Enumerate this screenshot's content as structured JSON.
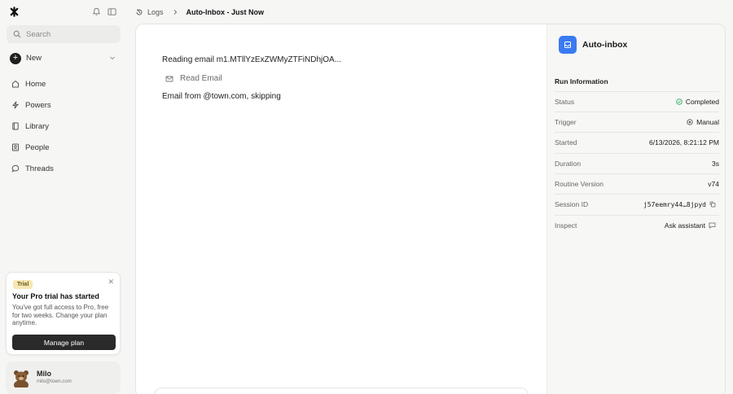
{
  "sidebar": {
    "search_placeholder": "Search",
    "new_label": "New",
    "nav": [
      {
        "label": "Home",
        "icon": "home-icon"
      },
      {
        "label": "Powers",
        "icon": "lightning-icon"
      },
      {
        "label": "Library",
        "icon": "book-icon"
      },
      {
        "label": "People",
        "icon": "contact-card-icon"
      },
      {
        "label": "Threads",
        "icon": "chat-bubble-icon"
      }
    ],
    "trial": {
      "badge": "Trial",
      "title": "Your Pro trial has started",
      "body": "You've got full access to Pro, free for two weeks. Change your plan anytime.",
      "button": "Manage plan"
    },
    "user": {
      "name": "Milo",
      "email": "milo@town.com"
    }
  },
  "breadcrumb": {
    "root": "Logs",
    "current": "Auto-Inbox - Just Now"
  },
  "log": {
    "line1": "Reading email m1.MTllYzExZWMyZTFiNDhjOA...",
    "tool": "Read Email",
    "line3": "Email from @town.com, skipping"
  },
  "panel": {
    "app_title": "Auto-inbox",
    "section_title": "Run Information",
    "rows": [
      {
        "key": "Status",
        "value": "Completed"
      },
      {
        "key": "Trigger",
        "value": "Manual"
      },
      {
        "key": "Started",
        "value": "6/13/2026, 8:21:12 PM"
      },
      {
        "key": "Duration",
        "value": "3s"
      },
      {
        "key": "Routine Version",
        "value": "v74"
      },
      {
        "key": "Session ID",
        "value": "j57eemry44…8jpyd"
      },
      {
        "key": "Inspect",
        "value": "Ask assistant"
      }
    ]
  },
  "colors": {
    "accent": "#3a7bf2",
    "success": "#3bb56b",
    "dark_button": "#2a2a2a"
  }
}
